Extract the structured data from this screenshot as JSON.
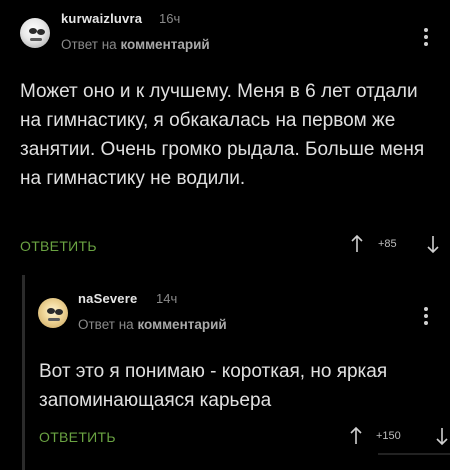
{
  "comments": [
    {
      "username": "kurwaizluvra",
      "time": "16ч",
      "reply_prefix": "Ответ на",
      "reply_target": "комментарий",
      "body": "Может оно и к лучшему. Меня в 6 лет отдали на гимнастику, я обкакалась на первом же занятии. Очень громко рыдала. Больше меня на гимнастику не водили.",
      "reply_label": "ОТВЕТИТЬ",
      "score": "+85"
    },
    {
      "username": "naSevere",
      "time": "14ч",
      "reply_prefix": "Ответ на",
      "reply_target": "комментарий",
      "body": "Вот это я понимаю - короткая, но яркая запоминающаяся карьера",
      "reply_label": "ОТВЕТИТЬ",
      "score": "+150"
    }
  ],
  "colors": {
    "background": "#000000",
    "reply_accent": "#6aa342",
    "muted_text": "#8a8a8a"
  },
  "icons": [
    "more-vertical-icon",
    "arrow-up-icon",
    "arrow-down-icon"
  ]
}
